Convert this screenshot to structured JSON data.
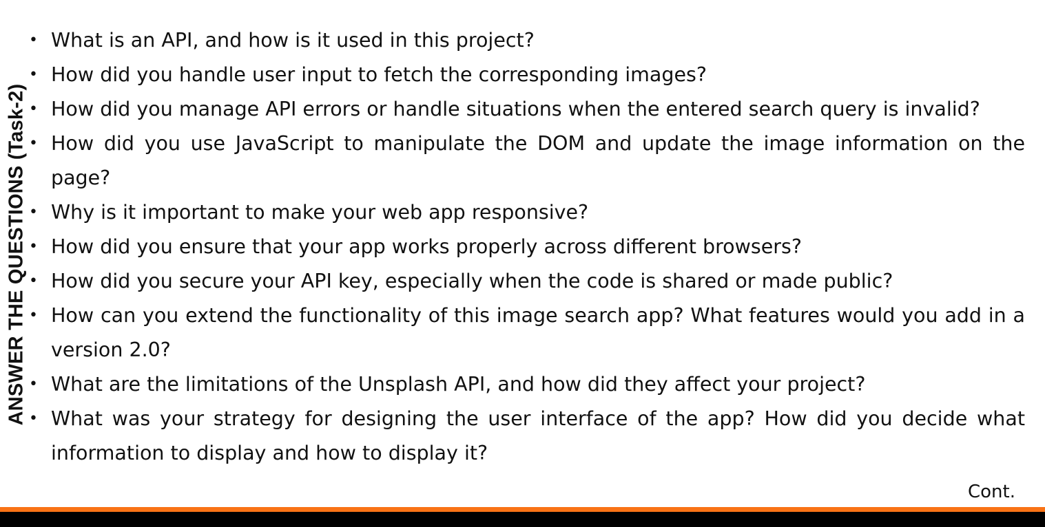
{
  "side_title": "ANSWER THE QUESTIONS (Task-2)",
  "bullet": "•",
  "questions": [
    "What is an API, and how is it used in this project?",
    "How did you handle user input to fetch the corresponding images?",
    "How did you manage API errors or handle situations when the entered search query is invalid?",
    "How did you use JavaScript to manipulate the DOM and update the image information on the page?",
    "Why is it important to make your web app responsive?",
    "How did you ensure that your app works properly across different browsers?",
    "How did you secure your API key, especially when the code is shared or made public?",
    "How can you extend the functionality of this image search app? What features would you add in a version 2.0?",
    "What are the limitations of the Unsplash API, and how did they affect your project?",
    "What was your strategy for designing the user interface of the app? How did you decide what information to display and how to display it?"
  ],
  "continuation_label": "Cont.",
  "colors": {
    "accent_bar": "#f97316",
    "footer_bar": "#000000",
    "text": "#111111",
    "background": "#ffffff"
  }
}
